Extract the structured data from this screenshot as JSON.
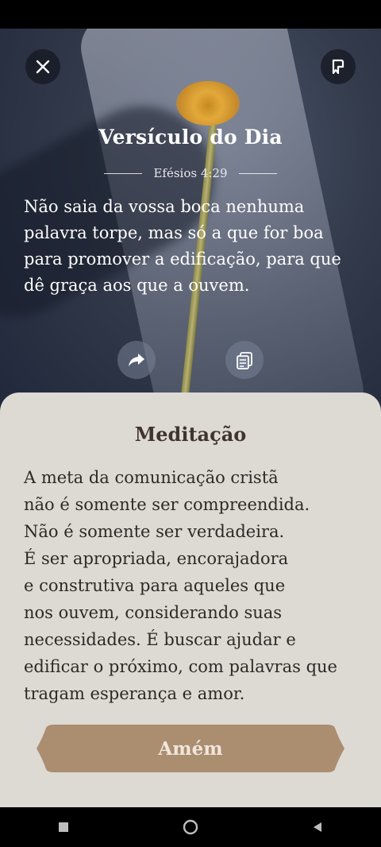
{
  "verse": {
    "title": "Versículo do Dia",
    "reference": "Efésios 4:29",
    "text": "Não saia da vossa boca nenhuma palavra torpe, mas só a que for boa para promover a edificação, para que dê graça aos que a ouvem."
  },
  "meditation": {
    "title": "Meditação",
    "text": "A meta da comunicação cristã\nnão é somente ser compreendida.\nNão é somente ser verdadeira.\nÉ ser apropriada, encorajadora\ne construtiva para aqueles que\nnos ouvem, considerando suas\nnecessidades. É buscar ajudar e\nedificar o próximo, com palavras que\ntragam esperança e amor."
  },
  "actions": {
    "amen_label": "Amém"
  },
  "icons": {
    "close": "close-icon",
    "bookmark": "bookmark-icon",
    "share": "share-icon",
    "copy": "copy-icon",
    "nav_recents": "recents-icon",
    "nav_home": "home-icon",
    "nav_back": "back-icon"
  },
  "colors": {
    "sheet_background": "#dddad4",
    "amen_button": "#ab8d70",
    "meditation_title": "#3f3430"
  }
}
